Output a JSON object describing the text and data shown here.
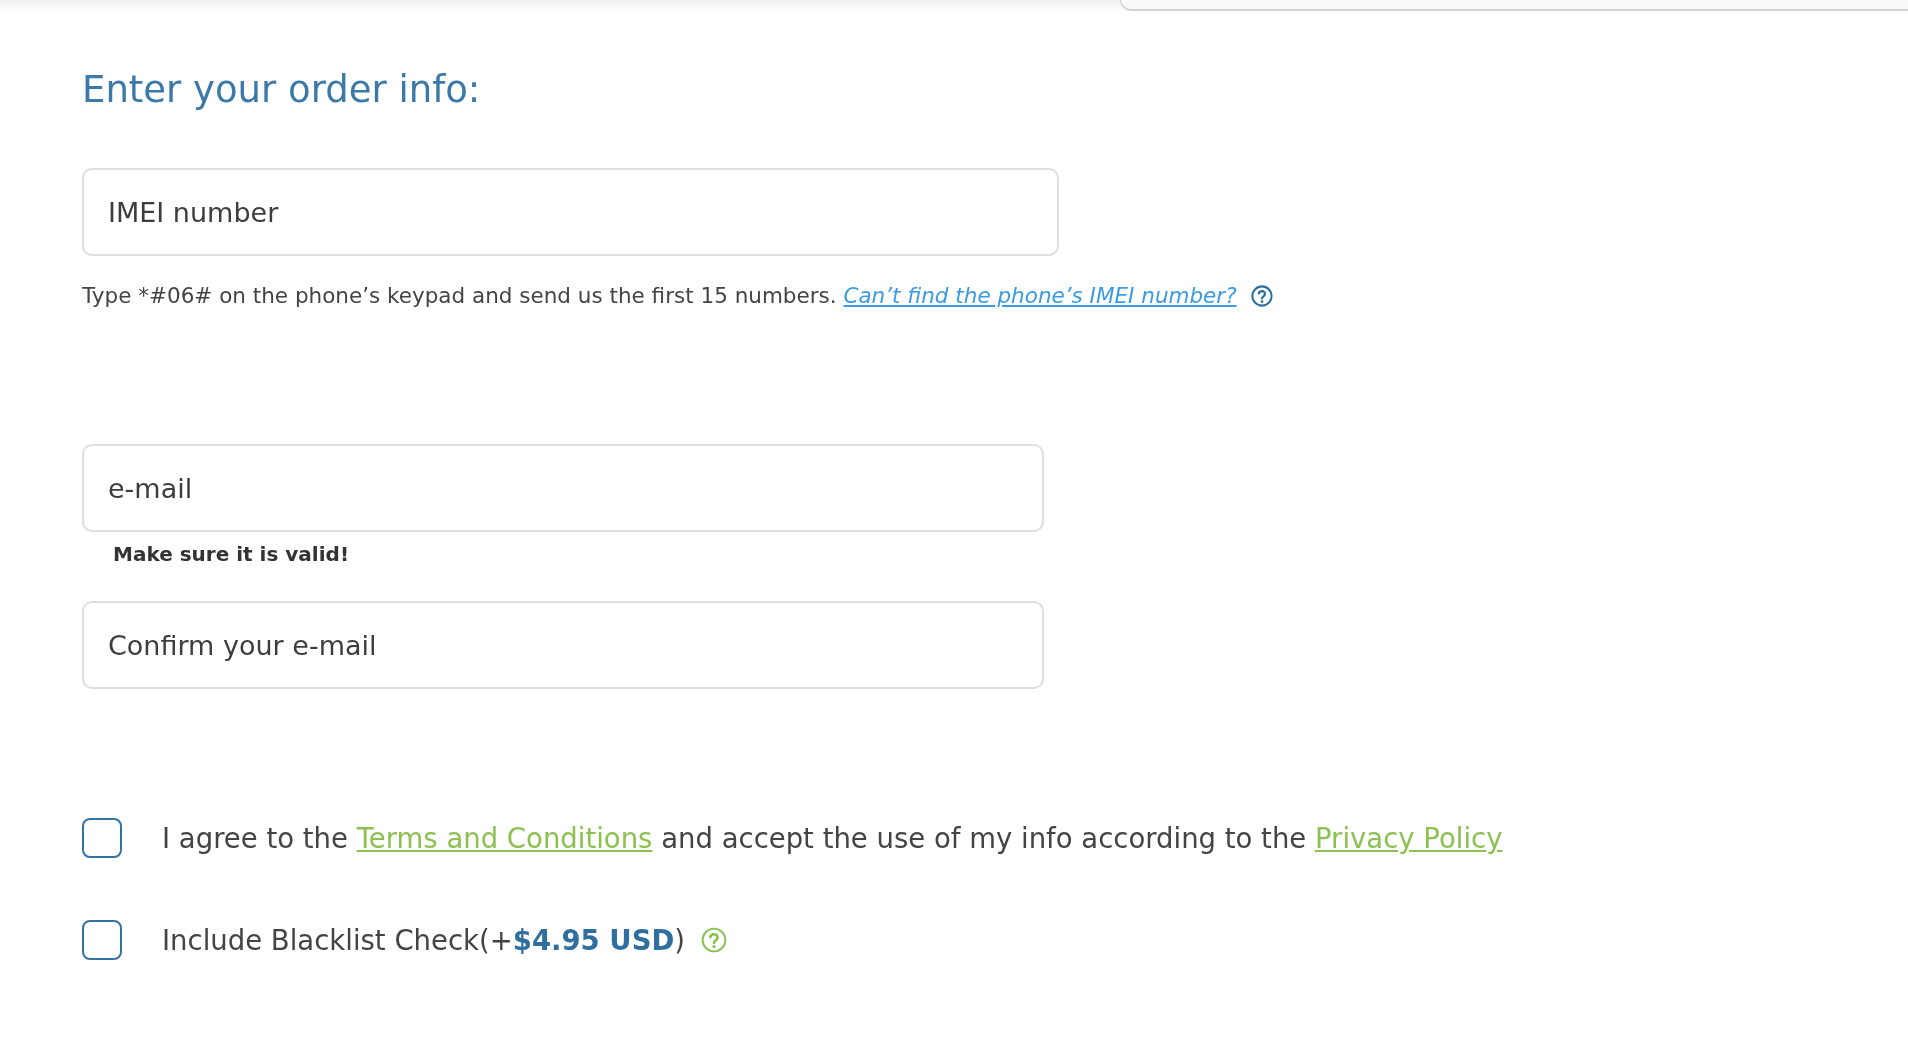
{
  "heading": "Enter your order info:",
  "imei_field": {
    "placeholder": "IMEI number"
  },
  "imei_hint": {
    "text": "Type *#06# on the phone’s keypad and send us the first 15 numbers.",
    "link": "Can’t find the phone’s IMEI number?"
  },
  "email_field": {
    "placeholder": "e-mail"
  },
  "email_note": "Make sure it is valid!",
  "confirm_email_field": {
    "placeholder": "Confirm your e-mail"
  },
  "checkboxes": [
    {
      "checked": false,
      "help": false,
      "label": [
        {
          "kind": "text",
          "text": "I agree to the "
        },
        {
          "kind": "link",
          "text": "Terms and Conditions"
        },
        {
          "kind": "text",
          "text": " and accept the use of my info according to the "
        },
        {
          "kind": "link",
          "text": "Privacy Policy"
        }
      ]
    },
    {
      "checked": false,
      "help": true,
      "label": [
        {
          "kind": "text",
          "text": "Include Blacklist Check(+**$4.95 USD**)"
        }
      ]
    }
  ]
}
